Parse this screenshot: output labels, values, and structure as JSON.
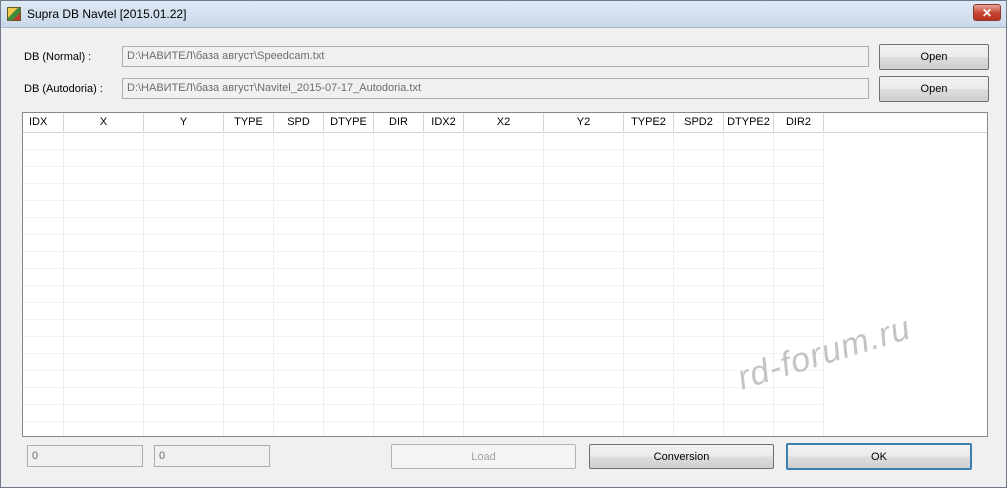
{
  "window": {
    "title": "Supra DB Navtel [2015.01.22]",
    "close_label": "✕"
  },
  "db_normal": {
    "label": "DB (Normal) :",
    "path": "D:\\НАВИТЕЛ\\база август\\Speedcam.txt",
    "open_label": "Open"
  },
  "db_autodoria": {
    "label": "DB (Autodoria) :",
    "path": "D:\\НАВИТЕЛ\\база август\\Navitel_2015-07-17_Autodoria.txt",
    "open_label": "Open"
  },
  "grid": {
    "columns": [
      "IDX",
      "X",
      "Y",
      "TYPE",
      "SPD",
      "DTYPE",
      "DIR",
      "IDX2",
      "X2",
      "Y2",
      "TYPE2",
      "SPD2",
      "DTYPE2",
      "DIR2"
    ]
  },
  "footer": {
    "count1": "0",
    "count2": "0",
    "load_label": "Load",
    "conversion_label": "Conversion",
    "ok_label": "OK"
  },
  "watermark": "rd-forum.ru"
}
